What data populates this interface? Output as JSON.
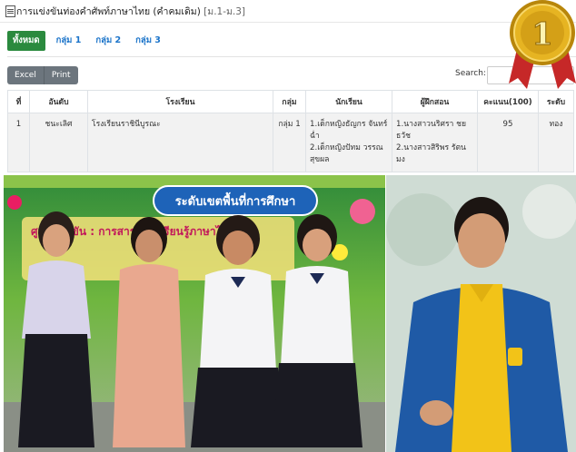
{
  "header": {
    "title": "การแข่งขันท่องคำศัพท์ภาษาไทย (คำคมเดิม)",
    "subtitle": "[ม.1-ม.3]"
  },
  "tabs": [
    {
      "label": "ทั้งหมด",
      "active": true
    },
    {
      "label": "กลุ่ม 1",
      "active": false
    },
    {
      "label": "กลุ่ม 2",
      "active": false
    },
    {
      "label": "กลุ่ม 3",
      "active": false
    }
  ],
  "toolbar": {
    "excel_label": "Excel",
    "print_label": "Print"
  },
  "search": {
    "label": "Search:",
    "value": ""
  },
  "table": {
    "headers": [
      "ที่",
      "อันดับ",
      "โรงเรียน",
      "กลุ่ม",
      "นักเรียน",
      "ผู้ฝึกสอน",
      "คะแนน(100)",
      "ระดับ"
    ],
    "rows": [
      {
        "num": "1",
        "rank": "ชนะเลิศ",
        "school": "โรงเรียนราชินีบูรณะ",
        "group": "กลุ่ม 1",
        "students": [
          "1.เด็กหญิงธัญกร จันทร์ฉ่ำ",
          "2.เด็กหญิงปัทม วรรณ สุขผล"
        ],
        "coaches": [
          "1.นางสาวนริศรา ชย ธวัช",
          "2.นางสาวสิริพร รัตน มง"
        ],
        "score": "95",
        "level": "ทอง"
      }
    ]
  },
  "photos": {
    "left_banner": "ระดับเขตพื้นที่การศึกษา",
    "left_sign": "ศูนย์แข่งขัน : การสาระการเรียนรู้ภาษาไทย"
  },
  "medal": {
    "number": "1",
    "color": "#d4a017"
  }
}
